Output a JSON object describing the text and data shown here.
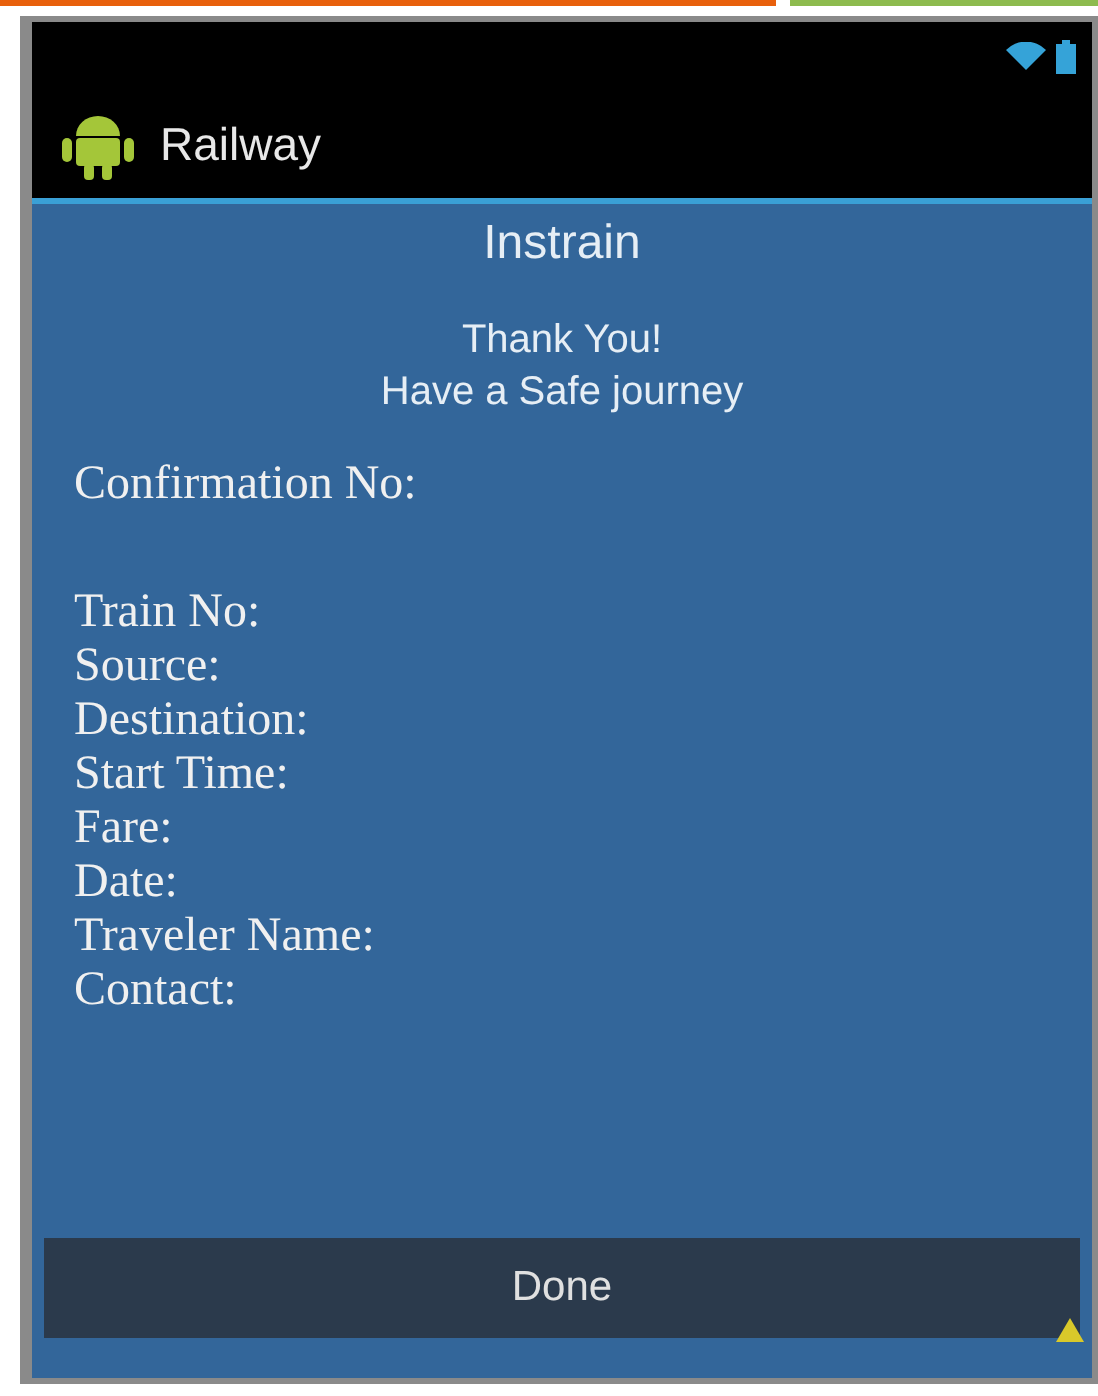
{
  "app_bar": {
    "title": "Railway"
  },
  "heading": "Instrain",
  "message": [
    "Thank You!",
    "Have a Safe journey"
  ],
  "confirmation_label": "Confirmation No:",
  "fields": [
    "Train No:",
    "Source:",
    "Destination:",
    "Start Time:",
    "Fare:",
    "Date:",
    "Traveler Name:",
    "Contact:"
  ],
  "button": "Done"
}
